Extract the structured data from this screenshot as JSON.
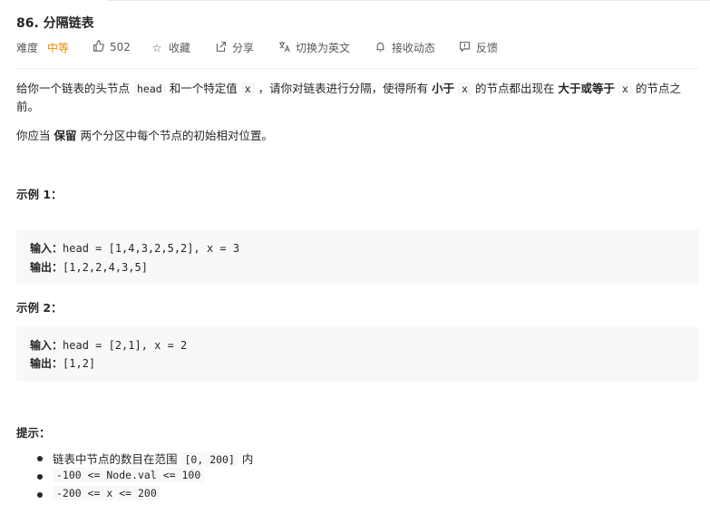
{
  "problem": {
    "title": "86. 分隔链表",
    "difficulty_label": "难度",
    "difficulty": "中等",
    "likes": "502",
    "favorite": "收藏",
    "share": "分享",
    "switch_lang": "切换为英文",
    "follow": "接收动态",
    "feedback": "反馈"
  },
  "icons": {
    "like": "thumbs-up-icon",
    "favorite": "star-icon",
    "share": "share-icon",
    "translate": "translate-icon",
    "bell": "bell-icon",
    "feedback": "feedback-icon"
  },
  "description": {
    "p1_a": "给你一个链表的头节点",
    "p1_code1": "head",
    "p1_b": "和一个特定值",
    "p1_code2": "x",
    "p1_c": "，请你对链表进行分隔，使得所有",
    "p1_bold1": "小于",
    "p1_code3": "x",
    "p1_d": "的节点都出现在",
    "p1_bold2": "大于或等于",
    "p1_code4": "x",
    "p1_e": "的节点之前。",
    "p2_a": "你应当",
    "p2_bold": "保留",
    "p2_b": "两个分区中每个节点的初始相对位置。"
  },
  "examples": [
    {
      "heading": "示例 1：",
      "input_label": "输入：",
      "input": "head = [1,4,3,2,5,2], x = 3",
      "output_label": "输出：",
      "output": "[1,2,2,4,3,5]"
    },
    {
      "heading": "示例 2：",
      "input_label": "输入：",
      "input": "head = [2,1], x = 2",
      "output_label": "输出：",
      "output": "[1,2]"
    }
  ],
  "hints": {
    "heading": "提示：",
    "items": [
      {
        "text_a": "链表中节点的数目在范围",
        "code": "[0, 200]",
        "text_b": "内"
      },
      {
        "code": "-100 <= Node.val <= 100"
      },
      {
        "code": "-200 <= x <= 200"
      }
    ]
  },
  "colors": {
    "difficulty_medium": "#ef8b00",
    "code_bg": "#f7f8fa",
    "text": "#262626"
  }
}
